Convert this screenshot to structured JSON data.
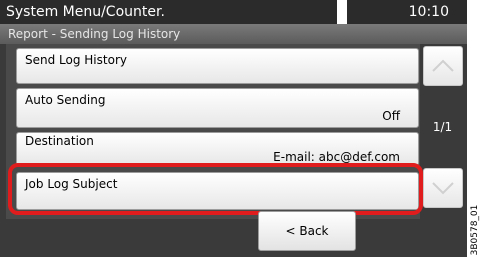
{
  "header": {
    "title": "System Menu/Counter.",
    "clock": "10:10"
  },
  "breadcrumb": "Report - Sending Log History",
  "list": [
    {
      "label": "Send Log History",
      "value": ""
    },
    {
      "label": "Auto Sending",
      "value": "Off"
    },
    {
      "label": "Destination",
      "value": "E-mail: abc@def.com"
    },
    {
      "label": "Job Log Subject",
      "value": ""
    }
  ],
  "pagination": {
    "indicator": "1/1"
  },
  "footer": {
    "back_label": "< Back"
  },
  "side_code": "3B0578_01",
  "icons": {
    "scroll_up": "chevron-up-icon",
    "scroll_down": "chevron-down-icon"
  },
  "colors": {
    "highlight": "#e01c1c",
    "panel": "#3a3a3a"
  }
}
